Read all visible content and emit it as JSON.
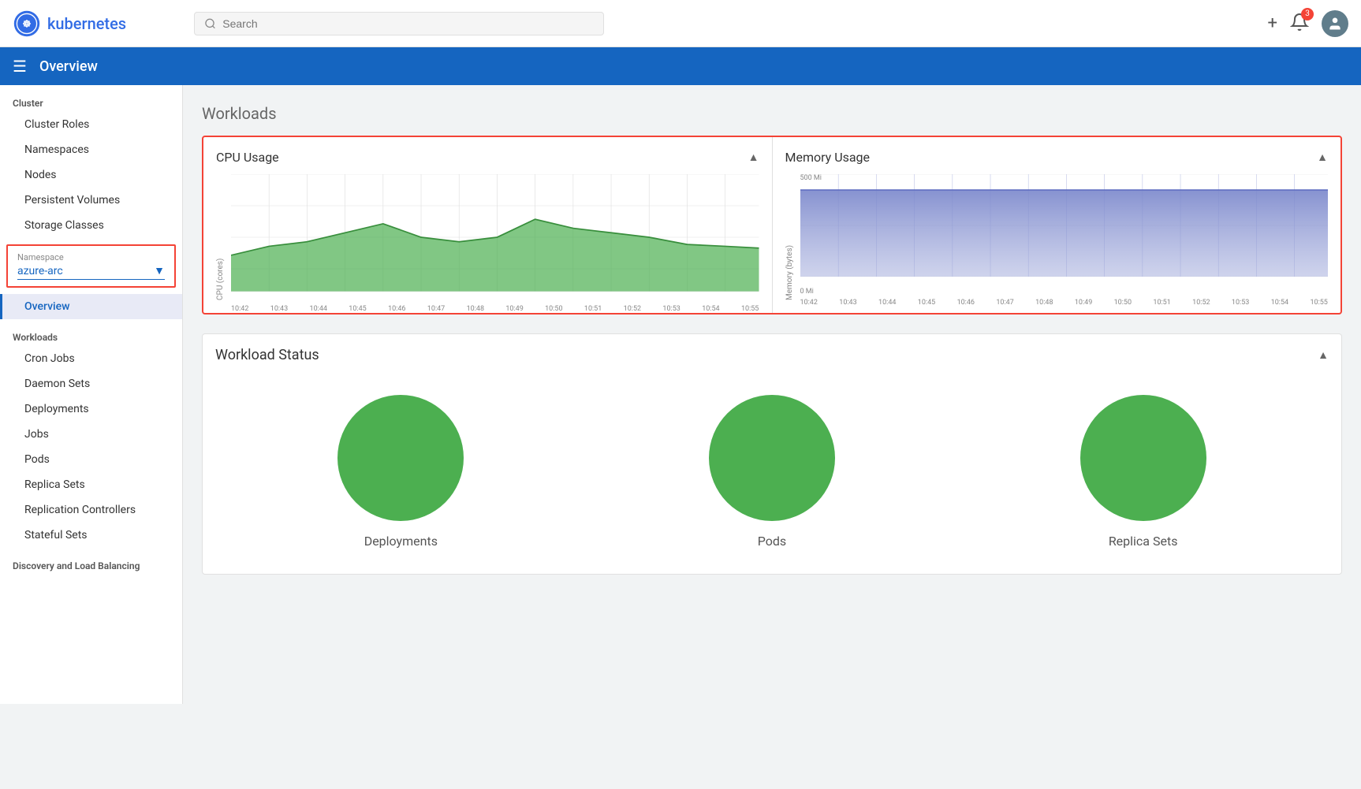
{
  "topbar": {
    "logo_text": "kubernetes",
    "search_placeholder": "Search",
    "plus_label": "+",
    "bell_badge": "3"
  },
  "overview_bar": {
    "title": "Overview"
  },
  "sidebar": {
    "cluster_label": "Cluster",
    "cluster_items": [
      {
        "label": "Cluster Roles",
        "id": "cluster-roles"
      },
      {
        "label": "Namespaces",
        "id": "namespaces"
      },
      {
        "label": "Nodes",
        "id": "nodes"
      },
      {
        "label": "Persistent Volumes",
        "id": "persistent-volumes"
      },
      {
        "label": "Storage Classes",
        "id": "storage-classes"
      }
    ],
    "namespace_label": "Namespace",
    "namespace_value": "azure-arc",
    "nav_overview": "Overview",
    "workloads_label": "Workloads",
    "workload_items": [
      {
        "label": "Cron Jobs",
        "id": "cron-jobs"
      },
      {
        "label": "Daemon Sets",
        "id": "daemon-sets"
      },
      {
        "label": "Deployments",
        "id": "deployments"
      },
      {
        "label": "Jobs",
        "id": "jobs"
      },
      {
        "label": "Pods",
        "id": "pods"
      },
      {
        "label": "Replica Sets",
        "id": "replica-sets"
      },
      {
        "label": "Replication Controllers",
        "id": "replication-controllers"
      },
      {
        "label": "Stateful Sets",
        "id": "stateful-sets"
      }
    ],
    "discovery_label": "Discovery and Load Balancing"
  },
  "main": {
    "workloads_title": "Workloads",
    "cpu_chart": {
      "title": "CPU Usage",
      "y_label": "CPU (cores)",
      "x_labels": [
        "10:42",
        "10:43",
        "10:44",
        "10:45",
        "10:46",
        "10:47",
        "10:48",
        "10:49",
        "10:50",
        "10:51",
        "10:52",
        "10:53",
        "10:54",
        "10:55"
      ],
      "y_max": "",
      "y_min": "0"
    },
    "memory_chart": {
      "title": "Memory Usage",
      "y_label": "Memory (bytes)",
      "y_max": "500 Mi",
      "y_min": "0 Mi"
    },
    "workload_status": {
      "title": "Workload Status",
      "circles": [
        {
          "label": "Deployments"
        },
        {
          "label": "Pods"
        },
        {
          "label": "Replica Sets"
        }
      ]
    }
  }
}
